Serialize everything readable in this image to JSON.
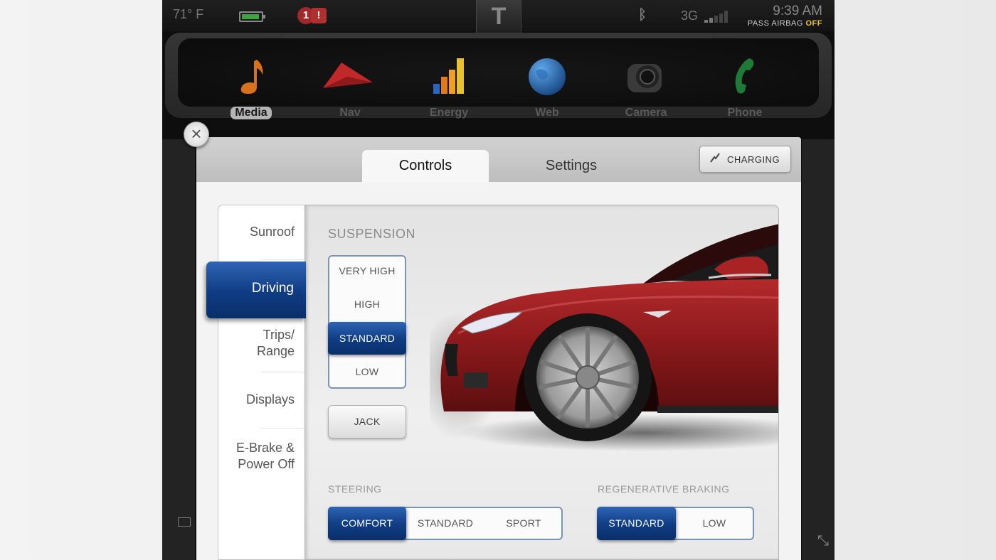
{
  "status_bar": {
    "temperature": "71° F",
    "network": "3G",
    "time": "9:39 AM",
    "airbag_label": "PASS AIRBAG",
    "airbag_state": "OFF",
    "alert_badge": "1",
    "alert_mark": "!"
  },
  "apps": [
    {
      "label": "Media",
      "icon": "music-note-icon"
    },
    {
      "label": "Nav",
      "icon": "navigation-arrow-icon"
    },
    {
      "label": "Energy",
      "icon": "energy-bars-icon"
    },
    {
      "label": "Web",
      "icon": "globe-icon"
    },
    {
      "label": "Camera",
      "icon": "camera-icon"
    },
    {
      "label": "Phone",
      "icon": "phone-handset-icon"
    }
  ],
  "active_app": "Media",
  "tabs": {
    "controls": "Controls",
    "settings": "Settings",
    "active": "Controls"
  },
  "charging_label": "CHARGING",
  "menu": {
    "items": [
      "Sunroof",
      "Driving",
      "Trips/",
      "Range",
      "Displays",
      "E-Brake &",
      "Power Off"
    ],
    "active": "Driving"
  },
  "suspension": {
    "label": "SUSPENSION",
    "options": [
      "VERY HIGH",
      "HIGH",
      "STANDARD",
      "LOW"
    ],
    "selected": "STANDARD",
    "jack_label": "JACK"
  },
  "steering": {
    "label": "STEERING",
    "options": [
      "COMFORT",
      "STANDARD",
      "SPORT"
    ],
    "selected": "COMFORT"
  },
  "regen": {
    "label": "REGENERATIVE BRAKING",
    "options": [
      "STANDARD",
      "LOW"
    ],
    "selected": "STANDARD"
  },
  "colors": {
    "accent_blue": "#0f3c82",
    "car_red": "#8e1a1c",
    "airbag_off": "#e9c535"
  }
}
